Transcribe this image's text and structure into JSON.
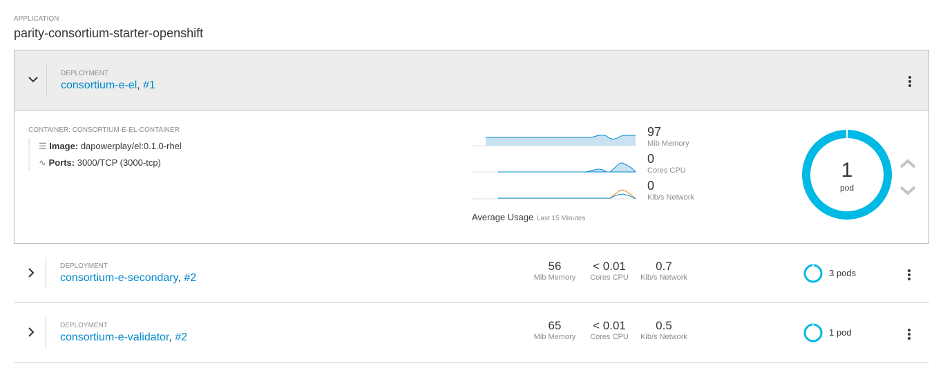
{
  "application": {
    "label": "APPLICATION",
    "name": "parity-consortium-starter-openshift"
  },
  "deployments": [
    {
      "label": "DEPLOYMENT",
      "name": "consortium-e-el",
      "revision": "#1",
      "expanded": true,
      "container": {
        "label": "CONTAINER: CONSORTIUM-E-EL-CONTAINER",
        "image_label": "Image:",
        "image": "dapowerplay/el:0.1.0-rhel",
        "ports_label": "Ports:",
        "ports": "3000/TCP (3000-tcp)"
      },
      "metrics": [
        {
          "value": "97",
          "unit": "Mib Memory"
        },
        {
          "value": "0",
          "unit": "Cores CPU"
        },
        {
          "value": "0",
          "unit": "Kib/s Network"
        }
      ],
      "usage_title": "Average Usage",
      "usage_period": "Last 15 Minutes",
      "pods": {
        "count": "1",
        "label": "pod"
      }
    },
    {
      "label": "DEPLOYMENT",
      "name": "consortium-e-secondary",
      "revision": "#2",
      "metrics": [
        {
          "value": "56",
          "unit": "Mib Memory"
        },
        {
          "value": "< 0.01",
          "unit": "Cores CPU"
        },
        {
          "value": "0.7",
          "unit": "Kib/s Network"
        }
      ],
      "pods": "3 pods"
    },
    {
      "label": "DEPLOYMENT",
      "name": "consortium-e-validator",
      "revision": "#2",
      "metrics": [
        {
          "value": "65",
          "unit": "Mib Memory"
        },
        {
          "value": "< 0.01",
          "unit": "Cores CPU"
        },
        {
          "value": "0.5",
          "unit": "Kib/s Network"
        }
      ],
      "pods": "1 pod"
    }
  ],
  "colors": {
    "link": "#0088ce",
    "donut": "#00b9e4",
    "chart_blue": "#0088ce",
    "chart_orange": "#ec7a08"
  }
}
